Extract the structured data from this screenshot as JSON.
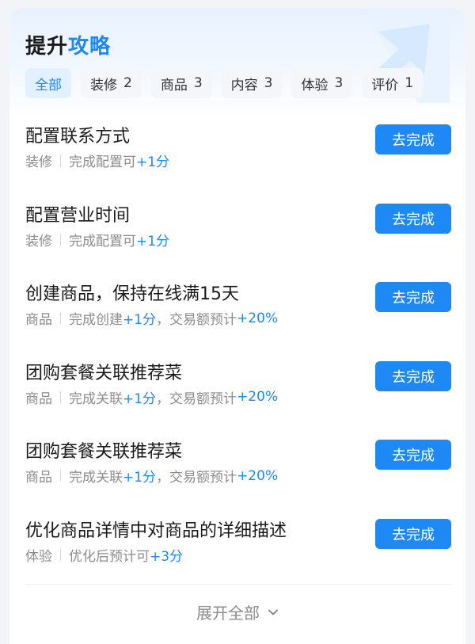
{
  "header": {
    "title_part1": "提升",
    "title_part2": "攻略",
    "colors": {
      "accent": "#1e88f5"
    }
  },
  "tabs": [
    {
      "label": "全部",
      "count": "",
      "active": true
    },
    {
      "label": "装修",
      "count": "2"
    },
    {
      "label": "商品",
      "count": "3"
    },
    {
      "label": "内容",
      "count": "3"
    },
    {
      "label": "体验",
      "count": "3"
    },
    {
      "label": "评价",
      "count": "1"
    }
  ],
  "items": [
    {
      "title": "配置联系方式",
      "category": "装修",
      "desc": "完成配置可",
      "gain": "+1分",
      "extra_text": "",
      "extra_gain": "",
      "button": "去完成"
    },
    {
      "title": "配置营业时间",
      "category": "装修",
      "desc": "完成配置可",
      "gain": "+1分",
      "extra_text": "",
      "extra_gain": "",
      "button": "去完成"
    },
    {
      "title": "创建商品，保持在线满15天",
      "category": "商品",
      "desc": "完成创建",
      "gain": "+1分",
      "extra_text": "，交易额预计",
      "extra_gain": "+20%",
      "button": "去完成"
    },
    {
      "title": "团购套餐关联推荐菜",
      "category": "商品",
      "desc": "完成关联",
      "gain": "+1分",
      "extra_text": "，交易额预计",
      "extra_gain": "+20%",
      "button": "去完成"
    },
    {
      "title": "团购套餐关联推荐菜",
      "category": "商品",
      "desc": "完成关联",
      "gain": "+1分",
      "extra_text": "，交易额预计",
      "extra_gain": "+20%",
      "button": "去完成"
    },
    {
      "title": "优化商品详情中对商品的详细描述",
      "category": "体验",
      "desc": "优化后预计可",
      "gain": "+3分",
      "extra_text": "",
      "extra_gain": "",
      "button": "去完成"
    }
  ],
  "footer": {
    "expand_label": "展开全部",
    "icon": "chevron-down-icon"
  }
}
